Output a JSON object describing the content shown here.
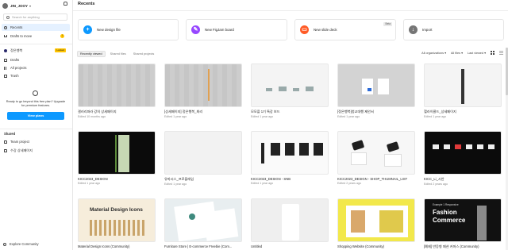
{
  "account": {
    "name": "JIN_JOOY",
    "chevron": "▾",
    "bell_icon": "bell-icon"
  },
  "search": {
    "placeholder": "Search for anything"
  },
  "nav": {
    "recents": "Recents",
    "drafts_to_move": "Drafts to move",
    "drafts_badge": "!",
    "team_name": "정은행복",
    "team_badge": "Locked",
    "drafts": "Drafts",
    "all_projects": "All projects",
    "trash": "Trash"
  },
  "upgrade": {
    "text": "Ready to go beyond this free plan? Upgrade for premium features.",
    "button": "View plans"
  },
  "shared": {
    "title": "Shared",
    "items": [
      "Team project",
      "수강 상세페이지"
    ]
  },
  "explore": "Explore Community",
  "main": {
    "title": "Recents"
  },
  "quick_actions": [
    {
      "label": "New design file",
      "color": "#0d99ff",
      "icon": "+"
    },
    {
      "label": "New FigJam board",
      "color": "#9747ff",
      "icon": "✎"
    },
    {
      "label": "New slide deck",
      "color": "#ff5b26",
      "icon": "▭",
      "badge": "Beta"
    },
    {
      "label": "Import",
      "color": "#757575",
      "icon": "↓"
    }
  ],
  "tabs": [
    "Recently viewed",
    "Shared files",
    "Shared projects"
  ],
  "filters": {
    "org": "All organizations ▾",
    "files": "All files ▾",
    "sort": "Last viewed ▾"
  },
  "files": [
    {
      "title": "갤러리파라 강의 상세페이지",
      "meta": "Edited 10 months ago"
    },
    {
      "title": "[상세페이지] 정은행복_최리",
      "meta": "Edited 1 year ago"
    },
    {
      "title": "모모플 1기 특강 보드",
      "meta": "Edited 1 year ago"
    },
    {
      "title": "[정은행복]청교대행 제안서",
      "meta": "Edited 1 year ago"
    },
    {
      "title": "헬라이클드_상세페이지",
      "meta": "Edited 1 year ago"
    },
    {
      "title": "KICC2023_DESIGN",
      "meta": "Edited 1 year ago"
    },
    {
      "title": "유마시스_프로플레임",
      "meta": "Edited 1 year ago"
    },
    {
      "title": "KICC2023_DESIGN - SNB",
      "meta": "Edited 1 year ago"
    },
    {
      "title": "KICC2023_DESIGN - SHOP_THUMNAIL_LIST",
      "meta": "Edited 2 years ago"
    },
    {
      "title": "KICC_Li_시안",
      "meta": "Edited 2 years ago"
    },
    {
      "title": "Material Design Icons (Community)",
      "meta": ""
    },
    {
      "title": "Furniture Store | E-commerce Freebie (Com...",
      "meta": ""
    },
    {
      "title": "Untitled",
      "meta": ""
    },
    {
      "title": "Shopping Website (Community)",
      "meta": ""
    },
    {
      "title": "[예제] 반응형 패션 커머스 (Community)",
      "meta": ""
    }
  ],
  "thumb_text": {
    "material": "Material Design Icons",
    "fashion": "Fashion Commerce",
    "fashion_sub": "Example 1   Responsive"
  }
}
